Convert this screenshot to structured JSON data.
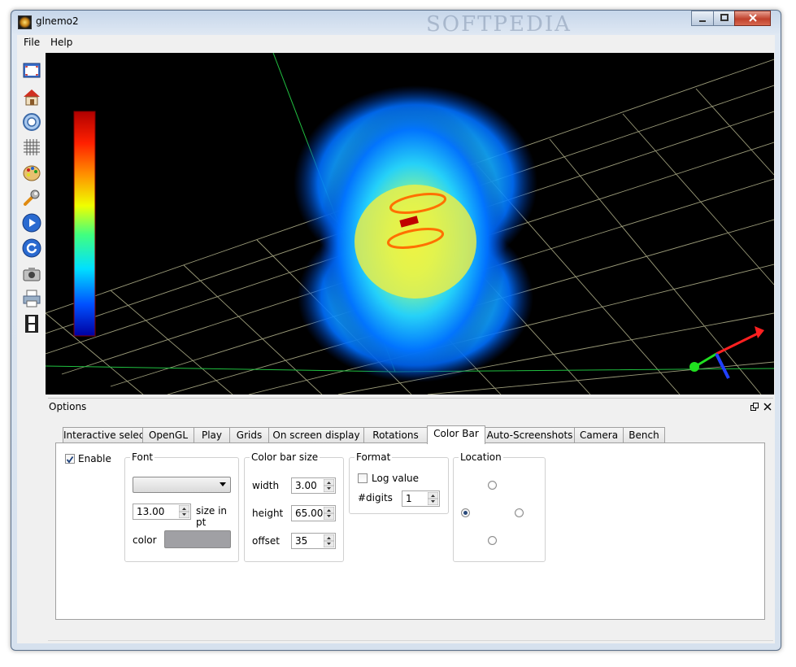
{
  "window": {
    "title": "glnemo2",
    "watermark": "SOFTPEDIA"
  },
  "menu": [
    "File",
    "Help"
  ],
  "toolbar": [
    "fullscreen-icon",
    "home-icon",
    "zoom-icon",
    "grid-icon",
    "palette-icon",
    "wrench-icon",
    "play-icon",
    "refresh-icon",
    "camera-icon",
    "printer-icon",
    "film-icon"
  ],
  "colorbar": {
    "colors": [
      "#0000a0",
      "#0050ff",
      "#00e0ff",
      "#40ff80",
      "#f0ff00",
      "#ff9000",
      "#ff2000",
      "#b00000"
    ]
  },
  "options": {
    "title": "Options",
    "tabs": [
      "Interactive select",
      "OpenGL",
      "Play",
      "Grids",
      "On screen display",
      "Rotations",
      "Color Bar",
      "Auto-Screenshots",
      "Camera",
      "Bench"
    ],
    "active_tab": "Color Bar",
    "enable": {
      "label": "Enable",
      "checked": true
    },
    "font": {
      "title": "Font",
      "selected": "",
      "size": "13.00",
      "size_label": "size in pt",
      "color_label": "color",
      "color_swatch": "#a0a0a4"
    },
    "size": {
      "title": "Color bar size",
      "width_label": "width",
      "width": "3.00",
      "height_label": "height",
      "height": "65.00",
      "offset_label": "offset",
      "offset": "35"
    },
    "format": {
      "title": "Format",
      "log_label": "Log value",
      "log_checked": false,
      "digits_label": "#digits",
      "digits": "1"
    },
    "location": {
      "title": "Location",
      "selected": "left"
    }
  }
}
